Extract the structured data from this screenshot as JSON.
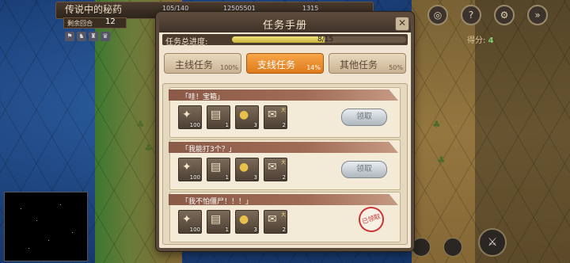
{
  "hud": {
    "title": "传说中的秘药",
    "resources": [
      "105/140",
      "12505501",
      "1315"
    ],
    "turn_label": "剩余回合",
    "turn_value": "12",
    "score_label": "得分:",
    "score_value": "4"
  },
  "dialog": {
    "title": "任务手册",
    "close_label": "✕",
    "progress_label": "任务总进度:",
    "progress_text": "8/15",
    "progress_value": 0.5333,
    "tabs": [
      {
        "label": "主线任务",
        "pct": "100%",
        "active": false
      },
      {
        "label": "支线任务",
        "pct": "14%",
        "active": true
      },
      {
        "label": "其他任务",
        "pct": "50%",
        "active": false
      }
    ],
    "quests": [
      {
        "title": "「哇！宝箱」",
        "rewards": [
          {
            "icon": "gem-icon",
            "count": "100",
            "tag": ""
          },
          {
            "icon": "scroll-icon",
            "count": "1",
            "tag": ""
          },
          {
            "icon": "gold-coins-icon",
            "count": "3",
            "tag": ""
          },
          {
            "icon": "map-scroll-icon",
            "count": "2",
            "tag": "大"
          }
        ],
        "action": "领取"
      },
      {
        "title": "「我能打3个？」",
        "rewards": [
          {
            "icon": "gem-icon",
            "count": "100",
            "tag": ""
          },
          {
            "icon": "scroll-icon",
            "count": "1",
            "tag": ""
          },
          {
            "icon": "gold-coins-icon",
            "count": "3",
            "tag": ""
          },
          {
            "icon": "map-scroll-icon",
            "count": "2",
            "tag": "大"
          }
        ],
        "action": "领取"
      },
      {
        "title": "「我不怕僵尸！！！」",
        "rewards": [
          {
            "icon": "gem-icon",
            "count": "100",
            "tag": ""
          },
          {
            "icon": "scroll-icon",
            "count": "1",
            "tag": ""
          },
          {
            "icon": "gold-coins-icon",
            "count": "3",
            "tag": ""
          },
          {
            "icon": "map-scroll-icon",
            "count": "2",
            "tag": "大"
          }
        ],
        "stamp": "已领取"
      }
    ]
  }
}
